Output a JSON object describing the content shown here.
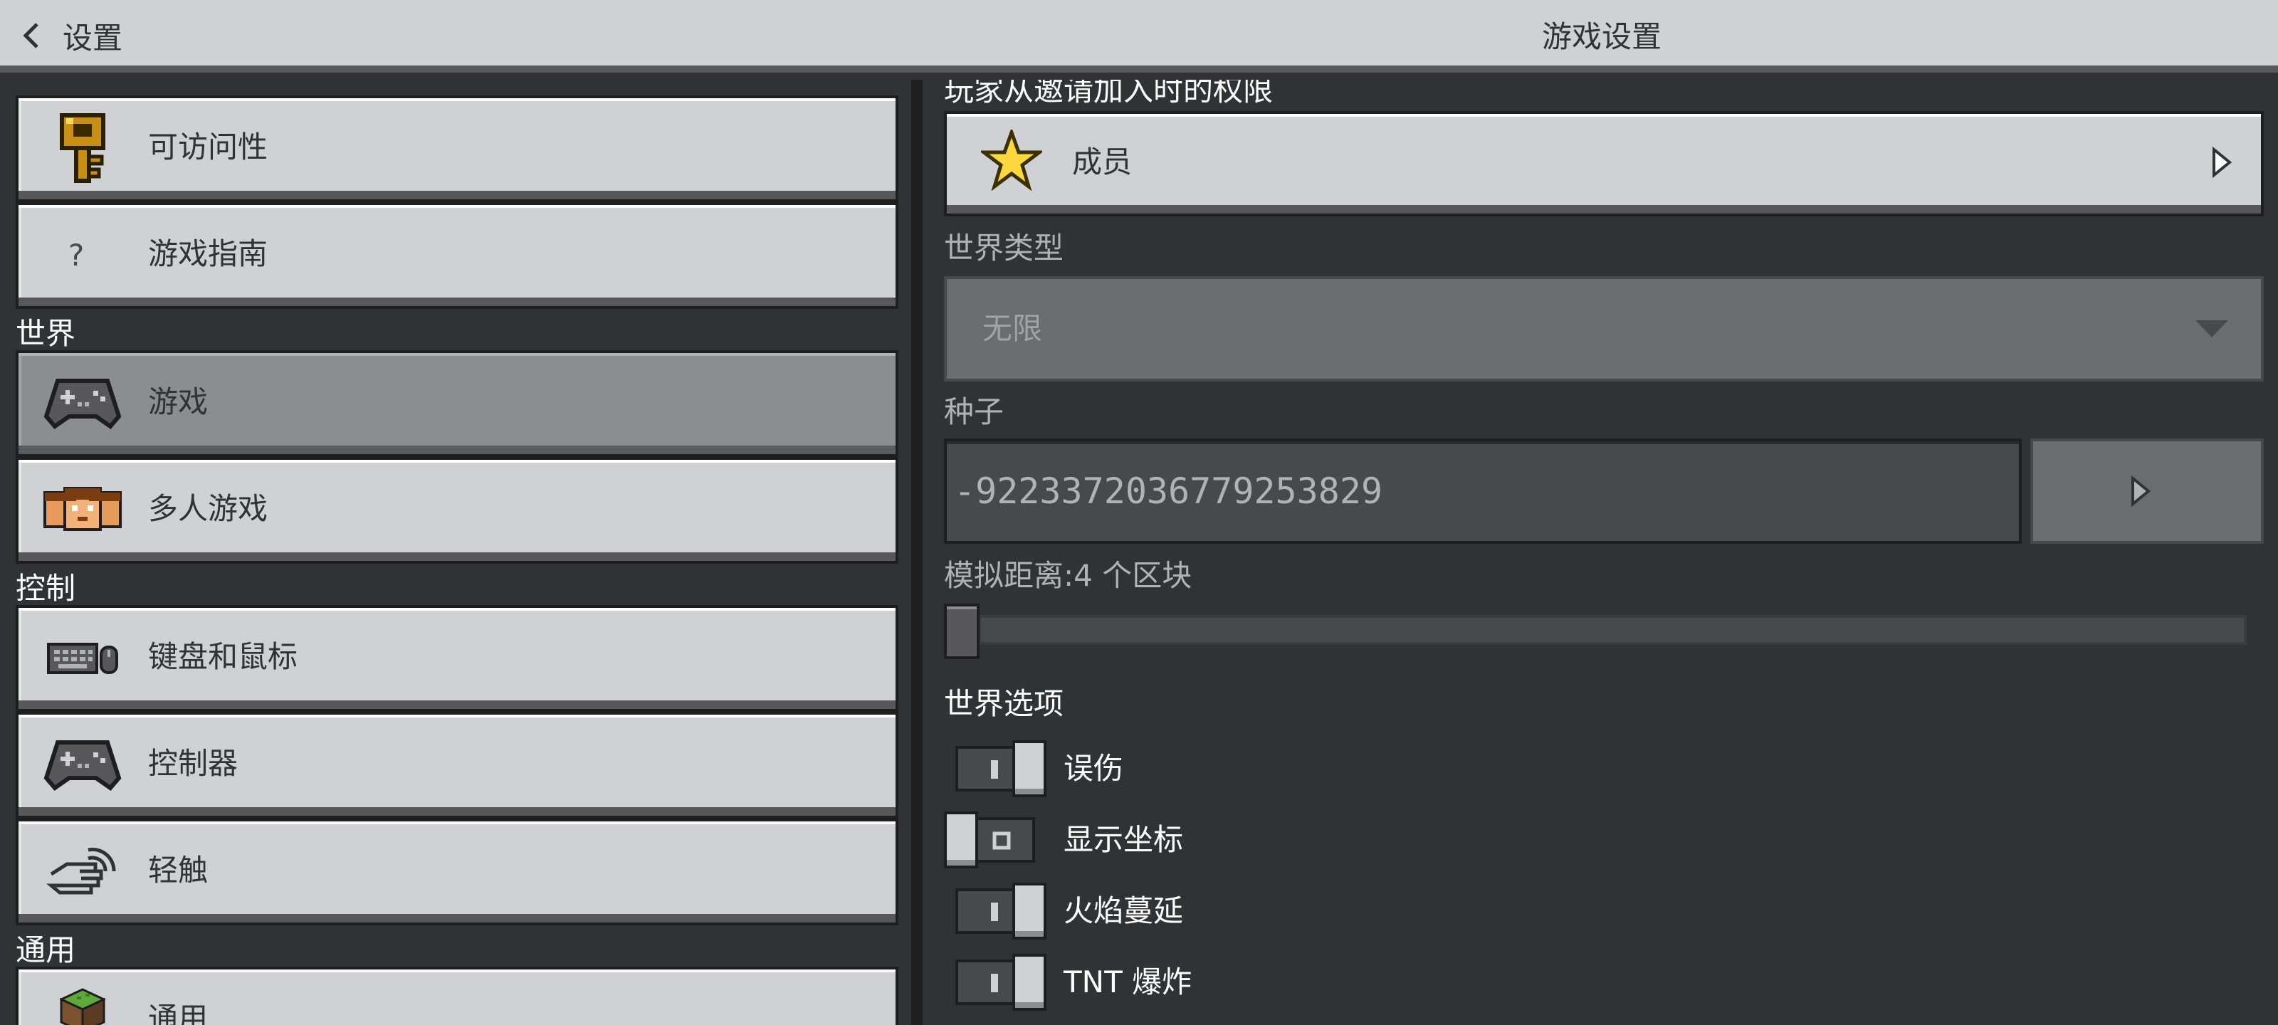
{
  "header": {
    "back_label": "设置",
    "title": "游戏设置"
  },
  "sidebar": {
    "items": [
      {
        "label": "可访问性",
        "icon": "key-icon"
      },
      {
        "label": "游戏指南",
        "icon": "question-icon",
        "glyph": "?"
      },
      {
        "label": "游戏",
        "icon": "gamepad-icon",
        "active": true
      },
      {
        "label": "多人游戏",
        "icon": "players-icon"
      },
      {
        "label": "键盘和鼠标",
        "icon": "keyboard-icon"
      },
      {
        "label": "控制器",
        "icon": "controller-icon"
      },
      {
        "label": "轻触",
        "icon": "touch-icon"
      },
      {
        "label": "通用",
        "icon": "grass-block-icon"
      }
    ],
    "sections": {
      "world": "世界",
      "controls": "控制",
      "general": "通用"
    }
  },
  "settings": {
    "invite_permission_label": "玩家从邀请加入时的权限",
    "invite_permission_value": "成员",
    "world_type_label": "世界类型",
    "world_type_value": "无限",
    "seed_label": "种子",
    "seed_value": "-9223372036779253829",
    "simulation_distance_label": "模拟距离:4 个区块",
    "simulation_distance_value": 4,
    "world_options_label": "世界选项",
    "toggles": [
      {
        "label": "误伤",
        "on": true
      },
      {
        "label": "显示坐标",
        "on": false
      },
      {
        "label": "火焰蔓延",
        "on": true
      },
      {
        "label": "TNT 爆炸",
        "on": true
      }
    ]
  },
  "colors": {
    "background": "#313233",
    "button": "#d0d1d4",
    "button_active": "#8c8d90",
    "header": "#d0d1d4",
    "star": "#ffd83d"
  }
}
